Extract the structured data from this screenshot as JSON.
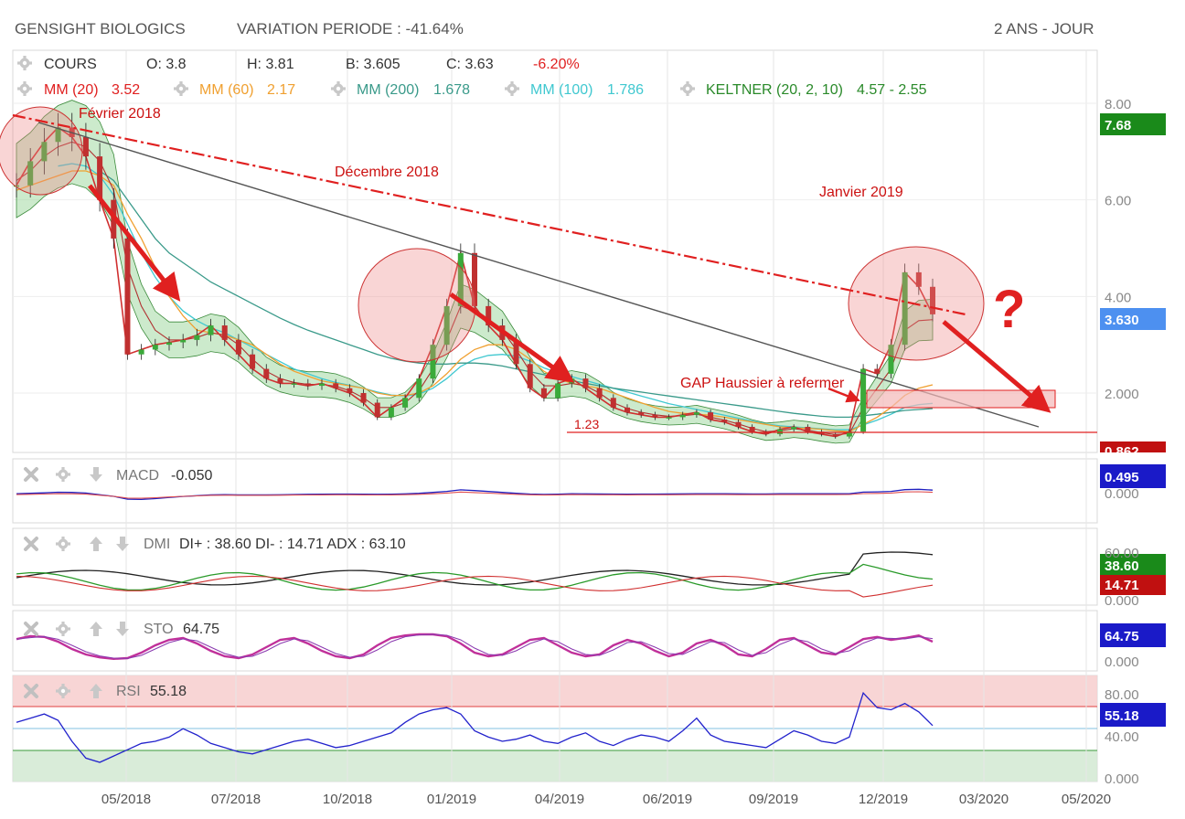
{
  "header": {
    "title": "GENSIGHT BIOLOGICS",
    "variation": "VARIATION PERIODE : -41.64%",
    "period": "2 ANS - JOUR"
  },
  "legend": {
    "cours": "COURS",
    "open": "O: 3.8",
    "high": "H: 3.81",
    "low": "B: 3.605",
    "close": "C: 3.63",
    "change": "-6.20%",
    "mm20": "MM (20)",
    "mm20_val": "3.52",
    "mm60": "MM (60)",
    "mm60_val": "2.17",
    "mm200": "MM (200)",
    "mm200_val": "1.678",
    "mm100": "MM (100)",
    "mm100_val": "1.786",
    "keltner": "KELTNER (20, 2, 10)",
    "keltner_val": "4.57 - 2.55"
  },
  "annotations": {
    "fev2018": "Février 2018",
    "dec2018": "Décembre 2018",
    "jan2019": "Janvier 2019",
    "gap": "GAP Haussier à refermer",
    "support": "1.23",
    "question": "?"
  },
  "price_badges": {
    "high": "7.68",
    "last": "3.630",
    "low": "0.862"
  },
  "indicators": {
    "macd_label": "MACD",
    "macd_val": "-0.050",
    "macd_badge": "0.495",
    "dmi_label": "DMI",
    "dmi_val": "DI+ : 38.60 DI- : 14.71 ADX : 63.10",
    "dmi_badge_plus": "38.60",
    "dmi_badge_minus": "14.71",
    "sto_label": "STO",
    "sto_val": "64.75",
    "sto_badge": "64.75",
    "rsi_label": "RSI",
    "rsi_val": "55.18",
    "rsi_badge": "55.18"
  },
  "colors": {
    "price": "#d03030",
    "mm60": "#f0a030",
    "mm200": "#3a9a8a",
    "mm100": "#40c8d0",
    "keltner": "#2a8a2a",
    "annotation": "#cc1111",
    "macd": "#2020c0",
    "signal": "#e05050",
    "rsi": "#2222cc",
    "sto": "#c0309a"
  },
  "chart_data": {
    "type": "line",
    "title": "GENSIGHT BIOLOGICS",
    "x_ticks": [
      "05/2018",
      "07/2018",
      "10/2018",
      "01/2019",
      "04/2019",
      "06/2019",
      "09/2019",
      "12/2019",
      "03/2020",
      "05/2020"
    ],
    "y_ticks": [
      "8.00",
      "6.00",
      "4.00",
      "2.000"
    ],
    "ylim": [
      0.8,
      8.3
    ],
    "series": [
      {
        "name": "COURS",
        "values": [
          6.3,
          6.8,
          7.2,
          7.5,
          7.3,
          6.9,
          6.0,
          5.2,
          2.8,
          2.9,
          3.0,
          3.05,
          3.1,
          3.2,
          3.4,
          3.1,
          2.8,
          2.5,
          2.3,
          2.2,
          2.2,
          2.15,
          2.2,
          2.1,
          2.0,
          1.8,
          1.5,
          1.7,
          1.9,
          2.3,
          3.0,
          3.8,
          4.9,
          3.8,
          3.4,
          3.1,
          2.6,
          2.1,
          1.9,
          2.2,
          2.3,
          2.1,
          1.9,
          1.7,
          1.6,
          1.55,
          1.5,
          1.5,
          1.55,
          1.6,
          1.45,
          1.4,
          1.3,
          1.2,
          1.15,
          1.25,
          1.3,
          1.2,
          1.15,
          1.1,
          1.2,
          2.5,
          2.4,
          3.0,
          4.5,
          4.2,
          3.63
        ]
      },
      {
        "name": "MM (20)",
        "values": [
          6.4,
          6.6,
          6.9,
          7.1,
          7.2,
          7.1,
          6.8,
          6.2,
          4.6,
          3.8,
          3.3,
          3.1,
          3.1,
          3.15,
          3.25,
          3.2,
          3.0,
          2.7,
          2.45,
          2.3,
          2.22,
          2.18,
          2.18,
          2.14,
          2.05,
          1.9,
          1.7,
          1.7,
          1.8,
          2.05,
          2.5,
          3.1,
          3.8,
          3.7,
          3.5,
          3.3,
          2.9,
          2.45,
          2.15,
          2.15,
          2.2,
          2.15,
          2.0,
          1.8,
          1.68,
          1.6,
          1.55,
          1.52,
          1.53,
          1.56,
          1.5,
          1.44,
          1.36,
          1.27,
          1.2,
          1.22,
          1.26,
          1.23,
          1.18,
          1.14,
          1.16,
          1.7,
          2.1,
          2.5,
          3.3,
          3.5,
          3.52
        ]
      },
      {
        "name": "MM (60)",
        "values": [
          6.2,
          6.3,
          6.4,
          6.5,
          6.6,
          6.6,
          6.5,
          6.3,
          5.7,
          5.2,
          4.6,
          4.0,
          3.6,
          3.3,
          3.25,
          3.2,
          3.1,
          3.0,
          2.8,
          2.6,
          2.45,
          2.35,
          2.25,
          2.2,
          2.15,
          2.1,
          2.0,
          1.95,
          1.95,
          2.0,
          2.15,
          2.4,
          2.7,
          2.9,
          3.0,
          3.0,
          2.9,
          2.7,
          2.45,
          2.3,
          2.2,
          2.15,
          2.1,
          2.0,
          1.9,
          1.8,
          1.7,
          1.62,
          1.58,
          1.56,
          1.54,
          1.5,
          1.45,
          1.4,
          1.35,
          1.3,
          1.28,
          1.27,
          1.25,
          1.22,
          1.2,
          1.35,
          1.5,
          1.7,
          1.95,
          2.1,
          2.17
        ]
      },
      {
        "name": "MM (200)",
        "values": [
          null,
          null,
          null,
          null,
          null,
          null,
          6.6,
          6.4,
          6.0,
          5.6,
          5.2,
          4.9,
          4.7,
          4.5,
          4.3,
          4.15,
          4.0,
          3.85,
          3.7,
          3.55,
          3.42,
          3.3,
          3.2,
          3.1,
          3.0,
          2.9,
          2.8,
          2.72,
          2.66,
          2.62,
          2.6,
          2.6,
          2.62,
          2.62,
          2.6,
          2.56,
          2.5,
          2.44,
          2.38,
          2.32,
          2.26,
          2.2,
          2.15,
          2.1,
          2.06,
          2.02,
          1.98,
          1.94,
          1.9,
          1.86,
          1.82,
          1.78,
          1.74,
          1.7,
          1.66,
          1.62,
          1.58,
          1.55,
          1.52,
          1.5,
          1.5,
          1.53,
          1.56,
          1.6,
          1.64,
          1.66,
          1.678
        ]
      },
      {
        "name": "MM (100)",
        "values": [
          null,
          null,
          null,
          6.7,
          6.75,
          6.7,
          6.5,
          6.1,
          5.5,
          4.9,
          4.4,
          4.0,
          3.7,
          3.5,
          3.35,
          3.25,
          3.1,
          2.95,
          2.8,
          2.65,
          2.5,
          2.4,
          2.3,
          2.22,
          2.16,
          2.1,
          2.02,
          1.96,
          1.94,
          1.98,
          2.1,
          2.3,
          2.55,
          2.7,
          2.78,
          2.8,
          2.76,
          2.66,
          2.52,
          2.42,
          2.34,
          2.26,
          2.18,
          2.1,
          2.02,
          1.94,
          1.86,
          1.78,
          1.72,
          1.66,
          1.6,
          1.54,
          1.48,
          1.42,
          1.36,
          1.32,
          1.3,
          1.28,
          1.26,
          1.24,
          1.24,
          1.34,
          1.44,
          1.56,
          1.7,
          1.76,
          1.786
        ]
      }
    ],
    "annotations_lines": [
      {
        "name": "1.23",
        "y": 1.23
      }
    ],
    "indicators": {
      "MACD": {
        "last": -0.05,
        "badge": 0.495,
        "ylim": [
          -0.5,
          0.7
        ]
      },
      "DMI": {
        "di_plus": 38.6,
        "di_minus": 14.71,
        "adx": 63.1,
        "ylim": [
          0,
          70
        ]
      },
      "STO": {
        "value": 64.75,
        "ylim": [
          0,
          100
        ],
        "values": [
          72,
          80,
          78,
          65,
          45,
          30,
          22,
          18,
          20,
          35,
          55,
          70,
          75,
          60,
          40,
          25,
          20,
          30,
          50,
          70,
          75,
          60,
          40,
          25,
          20,
          30,
          55,
          75,
          82,
          85,
          85,
          80,
          60,
          35,
          25,
          30,
          50,
          70,
          75,
          55,
          35,
          25,
          30,
          55,
          70,
          60,
          40,
          25,
          35,
          60,
          70,
          55,
          30,
          25,
          45,
          70,
          75,
          55,
          35,
          30,
          50,
          72,
          78,
          70,
          75,
          82,
          65
        ]
      },
      "RSI": {
        "value": 55.18,
        "ylim": [
          0,
          100
        ],
        "bands": [
          70,
          30
        ],
        "values": [
          58,
          62,
          66,
          60,
          40,
          24,
          20,
          26,
          32,
          38,
          40,
          44,
          52,
          46,
          38,
          34,
          30,
          28,
          32,
          36,
          40,
          42,
          38,
          34,
          36,
          40,
          44,
          48,
          58,
          66,
          70,
          72,
          66,
          50,
          44,
          40,
          42,
          46,
          40,
          38,
          44,
          48,
          40,
          36,
          42,
          46,
          44,
          40,
          50,
          62,
          46,
          40,
          38,
          36,
          34,
          42,
          50,
          46,
          40,
          38,
          44,
          86,
          72,
          70,
          76,
          68,
          55
        ]
      }
    }
  }
}
